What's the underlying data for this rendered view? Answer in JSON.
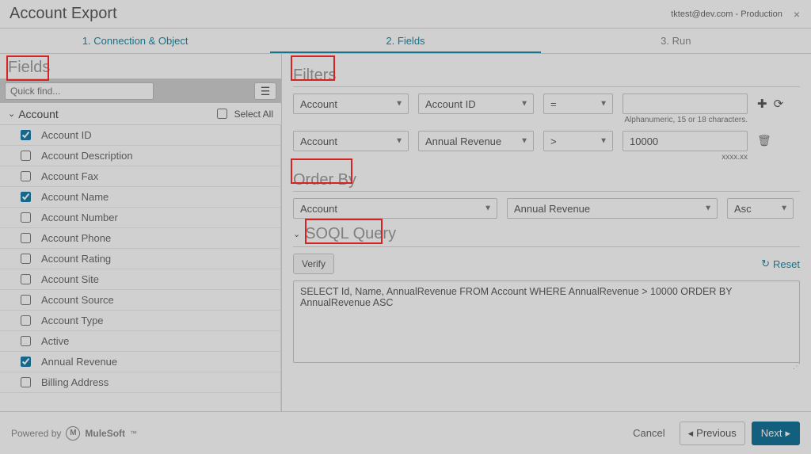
{
  "header": {
    "title": "Account Export",
    "context": "tktest@dev.com - Production"
  },
  "steps": {
    "s1": "1. Connection & Object",
    "s2": "2. Fields",
    "s3": "3. Run"
  },
  "fields": {
    "sectionTitle": "Fields",
    "quickFindPlaceholder": "Quick find...",
    "groupName": "Account",
    "selectAll": "Select All",
    "items": [
      {
        "label": "Account ID",
        "checked": true
      },
      {
        "label": "Account Description",
        "checked": false
      },
      {
        "label": "Account Fax",
        "checked": false
      },
      {
        "label": "Account Name",
        "checked": true
      },
      {
        "label": "Account Number",
        "checked": false
      },
      {
        "label": "Account Phone",
        "checked": false
      },
      {
        "label": "Account Rating",
        "checked": false
      },
      {
        "label": "Account Site",
        "checked": false
      },
      {
        "label": "Account Source",
        "checked": false
      },
      {
        "label": "Account Type",
        "checked": false
      },
      {
        "label": "Active",
        "checked": false
      },
      {
        "label": "Annual Revenue",
        "checked": true
      },
      {
        "label": "Billing Address",
        "checked": false
      }
    ]
  },
  "filters": {
    "sectionTitle": "Filters",
    "rows": [
      {
        "object": "Account",
        "field": "Account ID",
        "op": "=",
        "value": "",
        "hint": "Alphanumeric, 15 or 18 characters.",
        "showAddRefresh": true
      },
      {
        "object": "Account",
        "field": "Annual Revenue",
        "op": ">",
        "value": "10000",
        "hint": "xxxx.xx",
        "showDelete": true
      }
    ]
  },
  "orderBy": {
    "sectionTitle": "Order By",
    "object": "Account",
    "field": "Annual Revenue",
    "dir": "Asc"
  },
  "soql": {
    "sectionTitle": "SOQL Query",
    "verify": "Verify",
    "reset": "Reset",
    "query": "SELECT Id, Name, AnnualRevenue FROM Account WHERE AnnualRevenue > 10000 ORDER BY AnnualRevenue ASC"
  },
  "footer": {
    "poweredBy": "Powered by",
    "brand": "MuleSoft",
    "cancel": "Cancel",
    "previous": "Previous",
    "next": "Next"
  }
}
